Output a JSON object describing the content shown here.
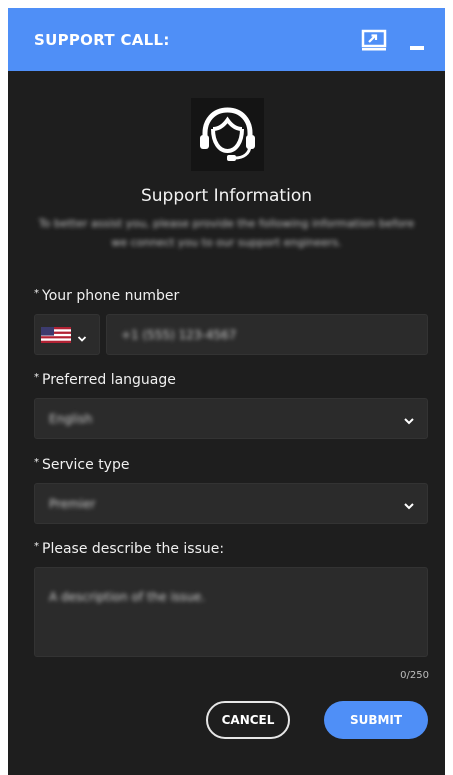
{
  "window": {
    "title": "SUPPORT CALL:"
  },
  "header": {
    "icon": "headset-agent-icon",
    "title": "Support Information",
    "description": "To better assist you, please provide the following information before we connect you to our support engineers."
  },
  "form": {
    "phone": {
      "label": "Your phone number",
      "required": "*",
      "country_flag": "us-flag-icon",
      "value": "+1 (555) 123-4567"
    },
    "language": {
      "label": "Preferred language",
      "required": "*",
      "value": "English"
    },
    "service": {
      "label": "Service type",
      "required": "*",
      "value": "Premier"
    },
    "issue": {
      "label": "Please describe the issue:",
      "required": "*",
      "value": "A description of the issue.",
      "counter": "0/250"
    }
  },
  "actions": {
    "cancel": "CANCEL",
    "submit": "SUBMIT"
  },
  "colors": {
    "accent": "#4f8ff7",
    "background": "#1e1e1e",
    "field": "#2b2b2b"
  }
}
